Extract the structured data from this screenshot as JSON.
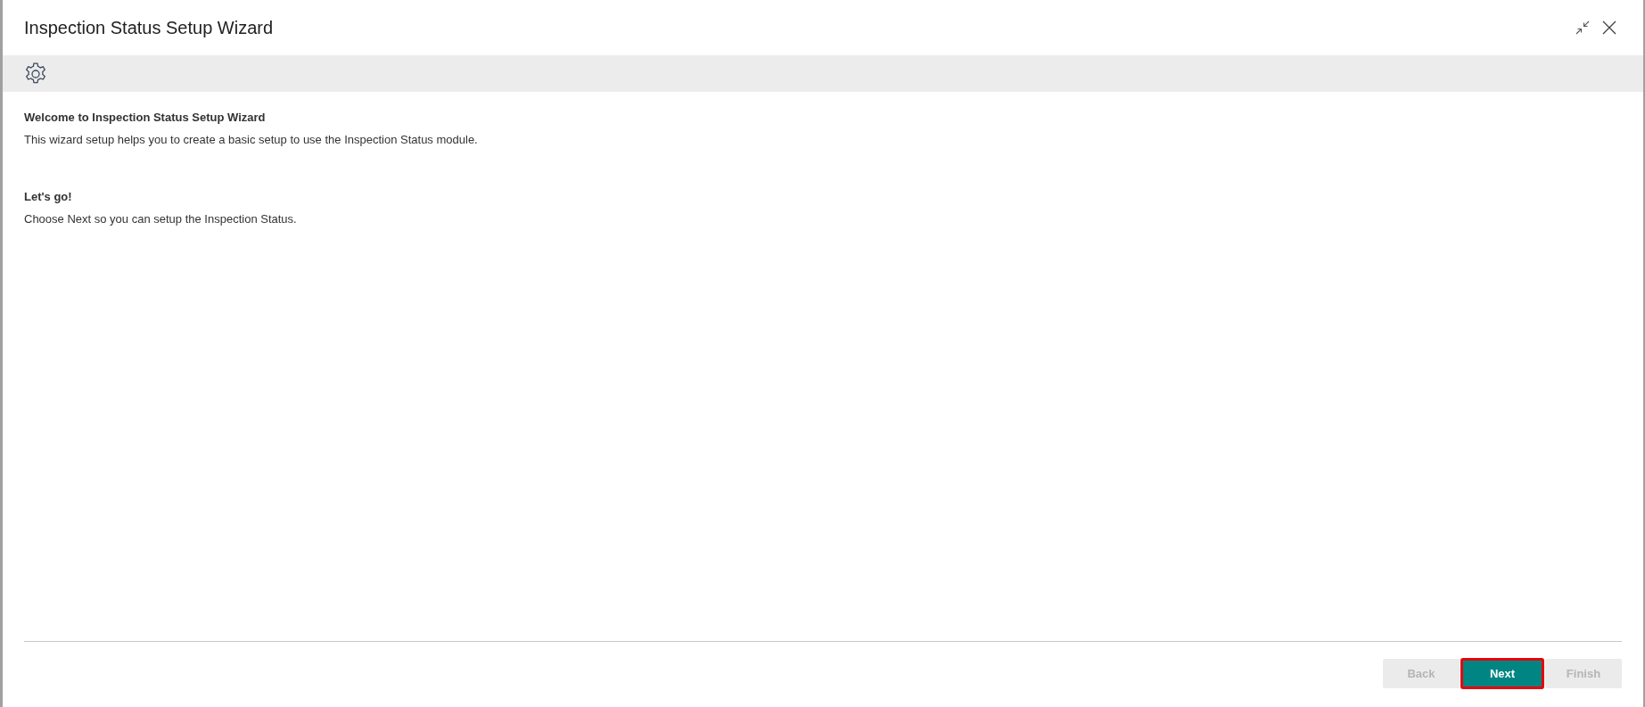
{
  "window": {
    "title": "Inspection Status Setup Wizard"
  },
  "content": {
    "sections": [
      {
        "heading": "Welcome to Inspection Status Setup Wizard",
        "text": "This wizard setup helps you to create a basic setup to use the Inspection Status module."
      },
      {
        "heading": "Let's go!",
        "text": "Choose Next so you can setup the Inspection Status."
      }
    ]
  },
  "buttons": [
    {
      "label": "Back",
      "disabled": true,
      "highlighted": false
    },
    {
      "label": "Next",
      "disabled": false,
      "highlighted": true
    },
    {
      "label": "Finish",
      "disabled": true,
      "highlighted": false
    }
  ]
}
